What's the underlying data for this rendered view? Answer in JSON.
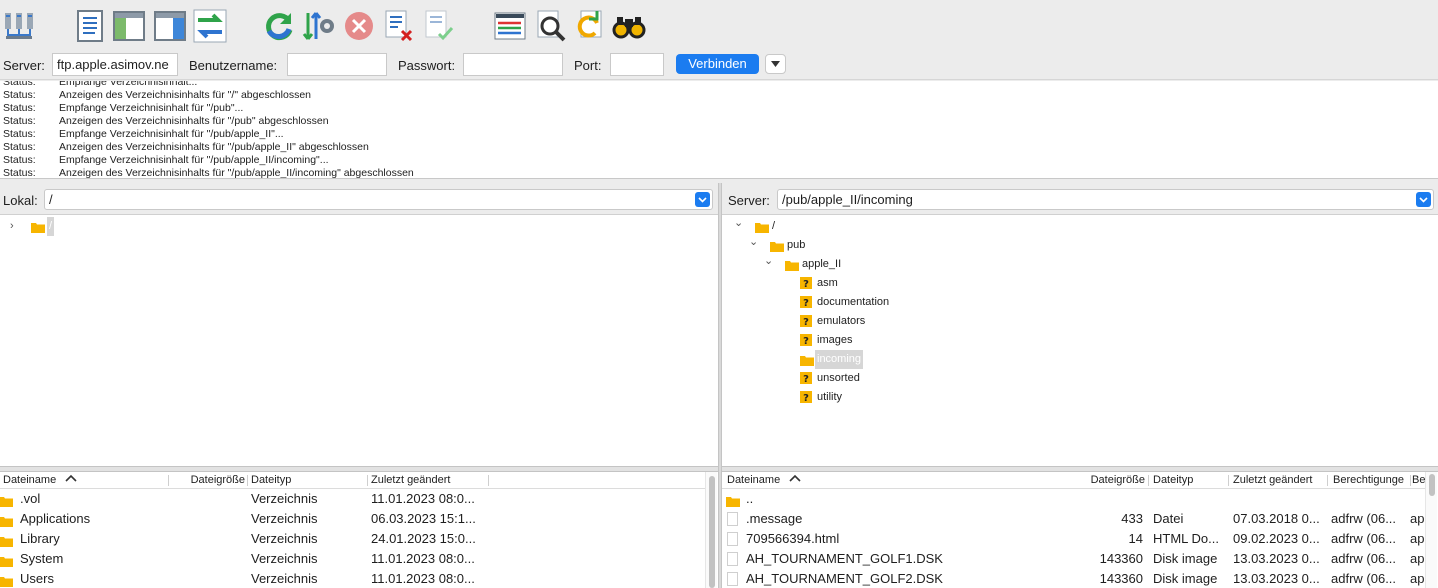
{
  "toolbar": {
    "buttons": [
      {
        "name": "site-manager-icon"
      },
      {
        "name": "toggle-log-icon"
      },
      {
        "name": "toggle-local-tree-icon"
      },
      {
        "name": "toggle-remote-tree-icon"
      },
      {
        "name": "transfer-queue-icon"
      },
      {
        "name": "refresh-icon"
      },
      {
        "name": "process-queue-icon"
      },
      {
        "name": "cancel-icon"
      },
      {
        "name": "disconnect-icon"
      },
      {
        "name": "reconnect-icon"
      },
      {
        "name": "directory-listing-filter-icon"
      },
      {
        "name": "compare-directories-icon"
      },
      {
        "name": "sync-browsing-icon"
      },
      {
        "name": "search-remote-icon"
      }
    ]
  },
  "quickconnect": {
    "server_label": "Server:",
    "server_value": "ftp.apple.asimov.ne",
    "user_label": "Benutzername:",
    "user_value": "",
    "pass_label": "Passwort:",
    "pass_value": "",
    "port_label": "Port:",
    "port_value": "",
    "connect_label": "Verbinden"
  },
  "log": [
    {
      "type": "Status:",
      "msg": "Empfange Verzeichnisinhalt..."
    },
    {
      "type": "Status:",
      "msg": "Anzeigen des Verzeichnisinhalts für \"/\" abgeschlossen"
    },
    {
      "type": "Status:",
      "msg": "Empfange Verzeichnisinhalt für \"/pub\"..."
    },
    {
      "type": "Status:",
      "msg": "Anzeigen des Verzeichnisinhalts für \"/pub\" abgeschlossen"
    },
    {
      "type": "Status:",
      "msg": "Empfange Verzeichnisinhalt für \"/pub/apple_II\"..."
    },
    {
      "type": "Status:",
      "msg": "Anzeigen des Verzeichnisinhalts für \"/pub/apple_II\" abgeschlossen"
    },
    {
      "type": "Status:",
      "msg": "Empfange Verzeichnisinhalt für \"/pub/apple_II/incoming\"..."
    },
    {
      "type": "Status:",
      "msg": "Anzeigen des Verzeichnisinhalts für \"/pub/apple_II/incoming\" abgeschlossen"
    }
  ],
  "local": {
    "path_label": "Lokal:",
    "path_value": "/",
    "tree": [
      {
        "label": "/",
        "chevron": "›",
        "selected": true
      }
    ],
    "columns": [
      "Dateiname",
      "Dateigröße",
      "Dateityp",
      "Zuletzt geändert"
    ],
    "rows": [
      {
        "name": ".vol",
        "size": "",
        "type": "Verzeichnis",
        "modified": "11.01.2023 08:0..."
      },
      {
        "name": "Applications",
        "size": "",
        "type": "Verzeichnis",
        "modified": "06.03.2023 15:1..."
      },
      {
        "name": "Library",
        "size": "",
        "type": "Verzeichnis",
        "modified": "24.01.2023 15:0..."
      },
      {
        "name": "System",
        "size": "",
        "type": "Verzeichnis",
        "modified": "11.01.2023 08:0..."
      },
      {
        "name": "Users",
        "size": "",
        "type": "Verzeichnis",
        "modified": "11.01.2023 08:0..."
      }
    ]
  },
  "remote": {
    "path_label": "Server:",
    "path_value": "/pub/apple_II/incoming",
    "tree": [
      {
        "label": "/",
        "level": 0,
        "chevron": "⌄",
        "icon": "folder"
      },
      {
        "label": "pub",
        "level": 1,
        "chevron": "⌄",
        "icon": "folder"
      },
      {
        "label": "apple_II",
        "level": 2,
        "chevron": "⌄",
        "icon": "folder"
      },
      {
        "label": "asm",
        "level": 3,
        "chevron": "",
        "icon": "unknown"
      },
      {
        "label": "documentation",
        "level": 3,
        "chevron": "",
        "icon": "unknown"
      },
      {
        "label": "emulators",
        "level": 3,
        "chevron": "",
        "icon": "unknown"
      },
      {
        "label": "images",
        "level": 3,
        "chevron": "",
        "icon": "unknown"
      },
      {
        "label": "incoming",
        "level": 3,
        "chevron": "",
        "icon": "folder",
        "selected": true
      },
      {
        "label": "unsorted",
        "level": 3,
        "chevron": "",
        "icon": "unknown"
      },
      {
        "label": "utility",
        "level": 3,
        "chevron": "",
        "icon": "unknown"
      }
    ],
    "columns": [
      "Dateiname",
      "Dateigröße",
      "Dateityp",
      "Zuletzt geändert",
      "Berechtigunge",
      "Be"
    ],
    "rows": [
      {
        "name": "..",
        "size": "",
        "type": "",
        "modified": "",
        "perm": "",
        "owner": "",
        "icon": "folder"
      },
      {
        "name": ".message",
        "size": "433",
        "type": "Datei",
        "modified": "07.03.2018 0...",
        "perm": "adfrw (06...",
        "owner": "ap",
        "icon": "file"
      },
      {
        "name": "709566394.html",
        "size": "14",
        "type": "HTML Do...",
        "modified": "09.02.2023 0...",
        "perm": "adfrw (06...",
        "owner": "ap",
        "icon": "file"
      },
      {
        "name": "AH_TOURNAMENT_GOLF1.DSK",
        "size": "143360",
        "type": "Disk image",
        "modified": "13.03.2023 0...",
        "perm": "adfrw (06...",
        "owner": "ap",
        "icon": "file"
      },
      {
        "name": "AH_TOURNAMENT_GOLF2.DSK",
        "size": "143360",
        "type": "Disk image",
        "modified": "13.03.2023 0...",
        "perm": "adfrw (06...",
        "owner": "ap",
        "icon": "file"
      }
    ]
  },
  "colors": {
    "accent": "#1b7cf0",
    "folder": "#f7b500",
    "selection": "#d6d6d6"
  }
}
